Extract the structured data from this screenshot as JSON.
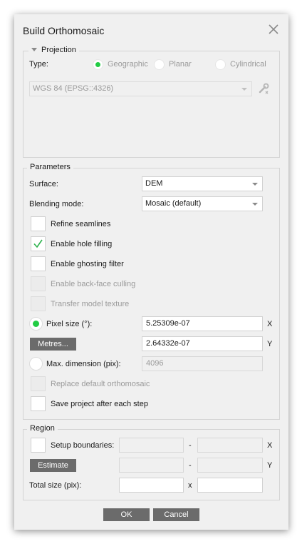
{
  "dialog": {
    "title": "Build Orthomosaic"
  },
  "projection": {
    "group_label": "Projection",
    "type_label": "Type:",
    "options": [
      "Geographic",
      "Planar",
      "Cylindrical"
    ],
    "selected": "Geographic",
    "crs": "WGS 84 (EPSG::4326)"
  },
  "parameters": {
    "group_label": "Parameters",
    "surface_label": "Surface:",
    "surface_value": "DEM",
    "blending_label": "Blending mode:",
    "blending_value": "Mosaic (default)",
    "refine_seamlines": "Refine seamlines",
    "enable_hole_filling": "Enable hole filling",
    "enable_ghosting_filter": "Enable ghosting filter",
    "enable_backface_culling": "Enable back-face culling",
    "transfer_model_texture": "Transfer model texture",
    "pixel_size_label": "Pixel size (°):",
    "pixel_size_x": "5.25309e-07",
    "pixel_size_y": "2.64332e-07",
    "x_axis": "X",
    "y_axis": "Y",
    "metres_button": "Metres...",
    "max_dimension_label": "Max. dimension (pix):",
    "max_dimension_value": "4096",
    "replace_default": "Replace default orthomosaic",
    "save_project": "Save project after each step"
  },
  "region": {
    "group_label": "Region",
    "setup_boundaries": "Setup boundaries:",
    "estimate_button": "Estimate",
    "total_size_label": "Total size (pix):",
    "dash": "-",
    "x_axis": "X",
    "y_axis": "Y",
    "times": "x"
  },
  "buttons": {
    "ok": "OK",
    "cancel": "Cancel"
  },
  "colors": {
    "radio_selected": "#22cc44",
    "checkmark": "#2bb24c",
    "button_bg": "#6b6b6b"
  }
}
